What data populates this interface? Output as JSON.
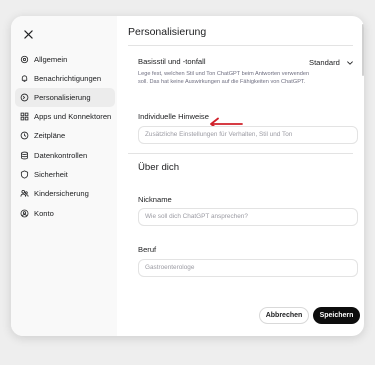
{
  "sidebar": {
    "items": [
      {
        "label": "Allgemein",
        "icon": "gear-icon",
        "active": false
      },
      {
        "label": "Benachrichtigungen",
        "icon": "bell-icon",
        "active": false
      },
      {
        "label": "Personalisierung",
        "icon": "personalization-icon",
        "active": true
      },
      {
        "label": "Apps und Konnektoren",
        "icon": "apps-icon",
        "active": false
      },
      {
        "label": "Zeitpläne",
        "icon": "clock-icon",
        "active": false
      },
      {
        "label": "Datenkontrollen",
        "icon": "database-icon",
        "active": false
      },
      {
        "label": "Sicherheit",
        "icon": "shield-icon",
        "active": false
      },
      {
        "label": "Kindersicherung",
        "icon": "parental-icon",
        "active": false
      },
      {
        "label": "Konto",
        "icon": "user-icon",
        "active": false
      }
    ]
  },
  "main": {
    "title": "Personalisierung",
    "style": {
      "label": "Basisstil und -tonfall",
      "hint": "Lege fest, welchen Stil und Ton ChatGPT beim Antworten verwenden soll. Das hat keine Auswirkungen auf die Fähigkeiten von ChatGPT.",
      "value": "Standard"
    },
    "instructions": {
      "label": "Individuelle Hinweise",
      "placeholder": "Zusätzliche Einstellungen für Verhalten, Stil und Ton"
    },
    "about": {
      "title": "Über dich",
      "nickname": {
        "label": "Nickname",
        "placeholder": "Wie soll dich ChatGPT ansprechen?"
      },
      "job": {
        "label": "Beruf",
        "value": "Gastroenterologe"
      }
    },
    "buttons": {
      "cancel": "Abbrechen",
      "save": "Speichern"
    }
  },
  "colors": {
    "accent_arrow": "#d0202a",
    "save_button": "#0d0d0d",
    "active_nav": "#ececec"
  }
}
